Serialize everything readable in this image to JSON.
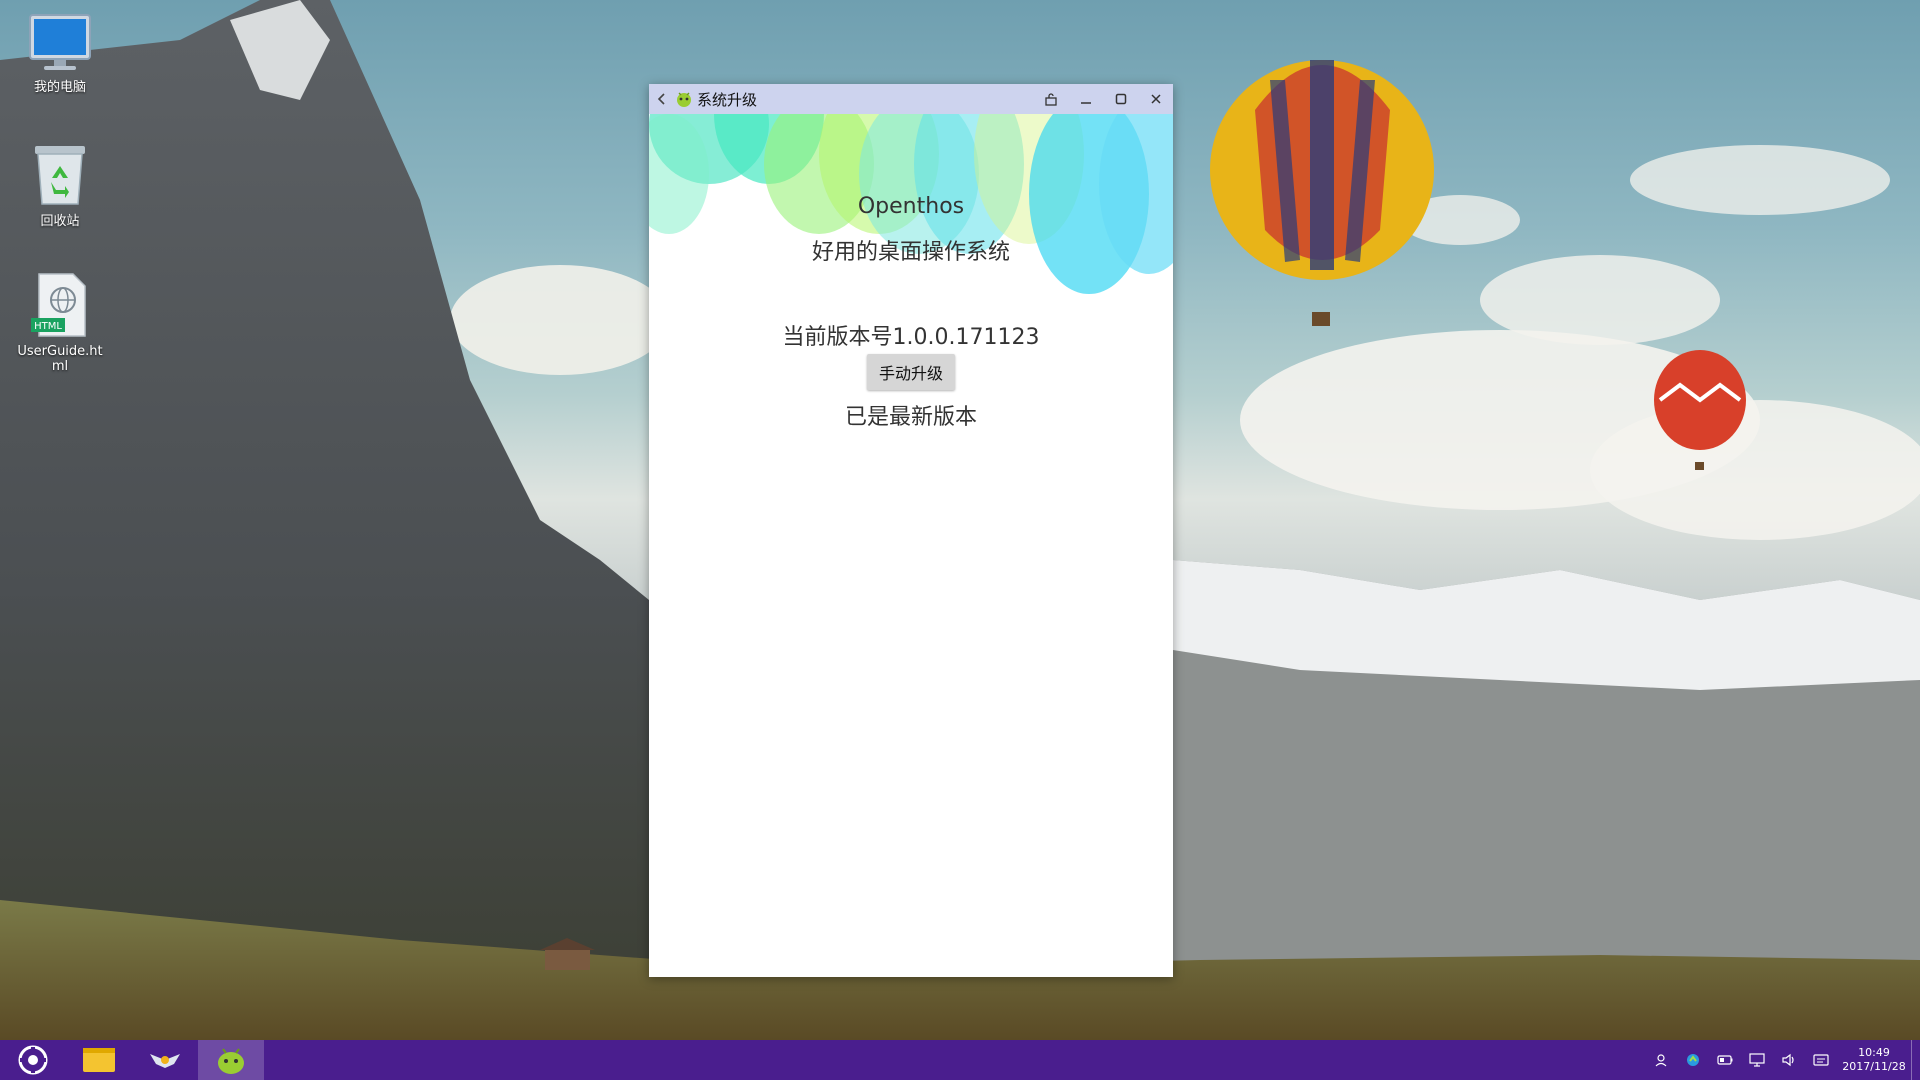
{
  "desktop": {
    "icons": [
      {
        "label": "我的电脑",
        "icon": "computer-monitor-icon"
      },
      {
        "label": "回收站",
        "icon": "recycle-bin-icon"
      },
      {
        "label": "UserGuide.html",
        "icon": "html-file-icon",
        "badge": "HTML"
      }
    ]
  },
  "window": {
    "title": "系统升级",
    "app_icon": "android-app-icon",
    "controls": [
      "back-icon",
      "rotate-lock-icon",
      "minimize-icon",
      "maximize-icon",
      "close-icon"
    ],
    "app_name": "Openthos",
    "slogan": "好用的桌面操作系统",
    "version_text": "当前版本号1.0.0.171123",
    "upgrade_button": "手动升级",
    "status_text": "已是最新版本"
  },
  "taskbar": {
    "start_icon": "openthos-logo-icon",
    "pinned": [
      "file-manager-icon",
      "browser-bird-icon",
      "system-upgrade-android-icon"
    ],
    "tray": [
      "user-icon",
      "network-icon",
      "battery-icon",
      "display-icon",
      "volume-icon",
      "notification-icon"
    ],
    "time": "10:49",
    "date": "2017/11/28"
  },
  "colors": {
    "titlebar": "#cdd3ee",
    "taskbar": "#4a1e8e",
    "button": "#d6d6d6"
  }
}
